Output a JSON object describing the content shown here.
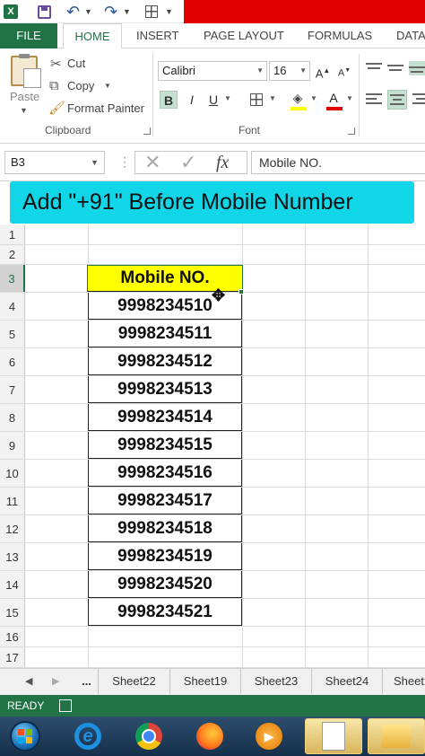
{
  "quick_access": {
    "app_icon": "excel-icon",
    "icons": [
      "save-icon",
      "undo-icon",
      "redo-icon",
      "table-icon"
    ]
  },
  "ribbon_tabs": [
    "FILE",
    "HOME",
    "INSERT",
    "PAGE LAYOUT",
    "FORMULAS",
    "DATA"
  ],
  "active_tab": "HOME",
  "clipboard": {
    "paste": "Paste",
    "cut": "Cut",
    "copy": "Copy",
    "format_painter": "Format Painter",
    "group_label": "Clipboard"
  },
  "font": {
    "name": "Calibri",
    "size": "16",
    "bold": "B",
    "italic": "I",
    "underline": "U",
    "group_label": "Font",
    "bold_active": true
  },
  "formula_bar": {
    "name_box": "B3",
    "fx": "fx",
    "formula": "Mobile NO."
  },
  "banner": {
    "text": "Add \"+91\" Before Mobile Number",
    "background": "#11d6e8"
  },
  "sheet": {
    "row_numbers": [
      "1",
      "2",
      "3",
      "4",
      "5",
      "6",
      "7",
      "8",
      "9",
      "10",
      "11",
      "12",
      "13",
      "14",
      "15",
      "16",
      "17"
    ],
    "selected_row": "3",
    "header": "Mobile NO.",
    "header_fill": "#ffff00",
    "numbers": [
      "9998234510",
      "9998234511",
      "9998234512",
      "9998234513",
      "9998234514",
      "9998234515",
      "9998234516",
      "9998234517",
      "9998234518",
      "9998234519",
      "9998234520",
      "9998234521"
    ]
  },
  "sheet_tabs": {
    "ellipsis": "...",
    "tabs": [
      "Sheet22",
      "Sheet19",
      "Sheet23",
      "Sheet24",
      "Sheet"
    ]
  },
  "status": {
    "text": "READY",
    "accent": "#217346"
  },
  "taskbar": {
    "icons": [
      "start-orb-icon",
      "internet-explorer-icon",
      "chrome-icon",
      "firefox-icon",
      "media-player-icon",
      "document-icon",
      "folder-icon"
    ]
  }
}
